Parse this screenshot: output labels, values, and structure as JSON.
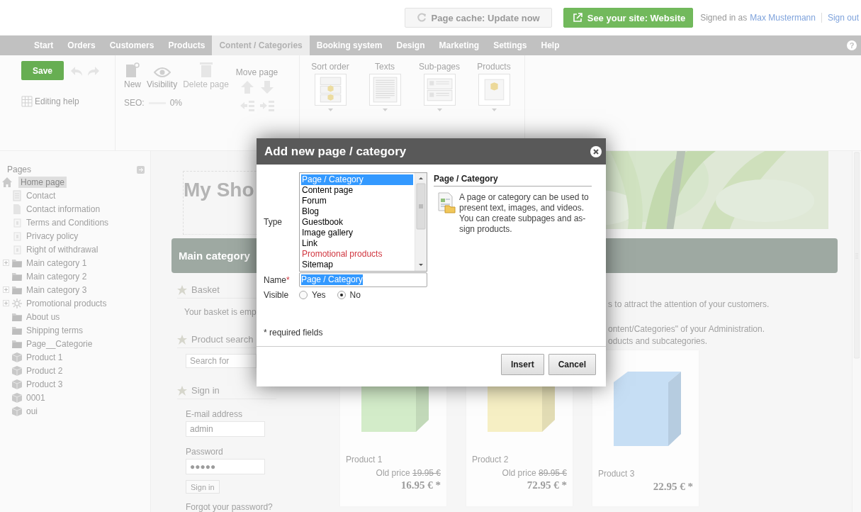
{
  "header": {
    "cache_button": "Page cache: Update now",
    "site_button": "See your site: Website",
    "signed_in_label": "Signed in as",
    "user_link": "Max Mustermann",
    "sign_out_link": "Sign out"
  },
  "nav": {
    "tabs": [
      {
        "label": "Start",
        "selected": false
      },
      {
        "label": "Orders",
        "selected": false
      },
      {
        "label": "Customers",
        "selected": false
      },
      {
        "label": "Products",
        "selected": false
      },
      {
        "label": "Content / Categories",
        "selected": true
      },
      {
        "label": "Booking system",
        "selected": false
      },
      {
        "label": "Design",
        "selected": false
      },
      {
        "label": "Marketing",
        "selected": false
      },
      {
        "label": "Settings",
        "selected": false
      },
      {
        "label": "Help",
        "selected": false
      }
    ],
    "help_glyph": "?"
  },
  "toolbar": {
    "save_button": "Save",
    "editing_help": "Editing help",
    "page_tools": [
      {
        "kind": "new",
        "label": "New",
        "disabled": false
      },
      {
        "kind": "visibility",
        "label": "Visibility",
        "disabled": false
      },
      {
        "kind": "delete",
        "label": "Delete page",
        "disabled": true
      }
    ],
    "move_page_label": "Move page",
    "seo_label": "SEO:",
    "seo_reading": "0%",
    "views": [
      {
        "kind": "sort",
        "label": "Sort order"
      },
      {
        "kind": "texts",
        "label": "Texts"
      },
      {
        "kind": "subpages",
        "label": "Sub-pages"
      },
      {
        "kind": "products",
        "label": "Products"
      }
    ]
  },
  "sidebar": {
    "title": "Pages",
    "items": [
      {
        "label": "Home page",
        "kind": "home",
        "selected": true,
        "expandable": false
      },
      {
        "label": "Contact",
        "kind": "list",
        "selected": false,
        "expandable": false
      },
      {
        "label": "Contact information",
        "kind": "document",
        "selected": false,
        "expandable": false
      },
      {
        "label": "Terms and Conditions",
        "kind": "legal",
        "selected": false,
        "expandable": false
      },
      {
        "label": "Privacy policy",
        "kind": "legal",
        "selected": false,
        "expandable": false
      },
      {
        "label": "Right of withdrawal",
        "kind": "legal",
        "selected": false,
        "expandable": false
      },
      {
        "label": "Main category 1",
        "kind": "folder",
        "selected": false,
        "expandable": true
      },
      {
        "label": "Main category 2",
        "kind": "folder",
        "selected": false,
        "expandable": false
      },
      {
        "label": "Main category 3",
        "kind": "folder",
        "selected": false,
        "expandable": true
      },
      {
        "label": "Promotional products",
        "kind": "promo",
        "selected": false,
        "expandable": true
      },
      {
        "label": "About us",
        "kind": "folder",
        "selected": false,
        "expandable": false
      },
      {
        "label": "Shipping terms",
        "kind": "folder",
        "selected": false,
        "expandable": false
      },
      {
        "label": "Page__Categorie",
        "kind": "folder",
        "selected": false,
        "expandable": false
      },
      {
        "label": "Product 1",
        "kind": "product",
        "selected": false,
        "expandable": false
      },
      {
        "label": "Product 2",
        "kind": "product",
        "selected": false,
        "expandable": false
      },
      {
        "label": "Product 3",
        "kind": "product",
        "selected": false,
        "expandable": false
      },
      {
        "label": "0001",
        "kind": "product",
        "selected": false,
        "expandable": false
      },
      {
        "label": "oui",
        "kind": "product",
        "selected": false,
        "expandable": false
      }
    ]
  },
  "content": {
    "title": "My Sho",
    "category_bar": "Main category",
    "basket": {
      "heading": "Basket",
      "text": "Your basket is emp"
    },
    "search": {
      "heading": "Product search",
      "placeholder": "Search for"
    },
    "sign_in": {
      "heading": "Sign in",
      "email_label": "E-mail address",
      "email_value": "admin",
      "password_label": "Password",
      "password_value": "●●●●●",
      "button": "Sign in",
      "forgot_link": "Forgot your password?"
    },
    "intro": [
      "s to attract the attention of your customers.",
      "ontent/Categories\" of your Administration.",
      "oducts and subcategories."
    ],
    "products": [
      {
        "name": "Product 1",
        "old_price_label": "Old price",
        "old_price": "19.95 €",
        "price": "16.95 € *",
        "color": "#d3ecc9"
      },
      {
        "name": "Product 2",
        "old_price_label": "Old price",
        "old_price": "89.95 €",
        "price": "72.95 € *",
        "color": "#f6efc4"
      },
      {
        "name": "Product 3",
        "price": "22.95 € *",
        "color": "#c6def4"
      }
    ]
  },
  "dialog": {
    "title": "Add new page / category",
    "type_label": "Type",
    "types": [
      {
        "label": "Page / Category",
        "kind": "standard",
        "selected": true
      },
      {
        "label": "Content page",
        "kind": "standard",
        "selected": false
      },
      {
        "label": "Forum",
        "kind": "standard",
        "selected": false
      },
      {
        "label": "Blog",
        "kind": "standard",
        "selected": false
      },
      {
        "label": "Guestbook",
        "kind": "standard",
        "selected": false
      },
      {
        "label": "Image gallery",
        "kind": "standard",
        "selected": false
      },
      {
        "label": "Link",
        "kind": "standard",
        "selected": false
      },
      {
        "label": "Promotional products",
        "kind": "promotional",
        "selected": false
      },
      {
        "label": "Sitemap",
        "kind": "standard",
        "selected": false
      }
    ],
    "name_label": "Name",
    "required_mark": "*",
    "name_value": "Page / Category",
    "visible_label": "Visible",
    "visible_options": [
      {
        "label": "Yes",
        "selected": false
      },
      {
        "label": "No",
        "selected": true
      }
    ],
    "info_title": "Page / Category",
    "info_text": "A page or category can be used to present text, images, and videos. You can create subpages and as-sign products.",
    "required_note": "* required fields",
    "buttons": [
      "Insert",
      "Cancel"
    ]
  }
}
